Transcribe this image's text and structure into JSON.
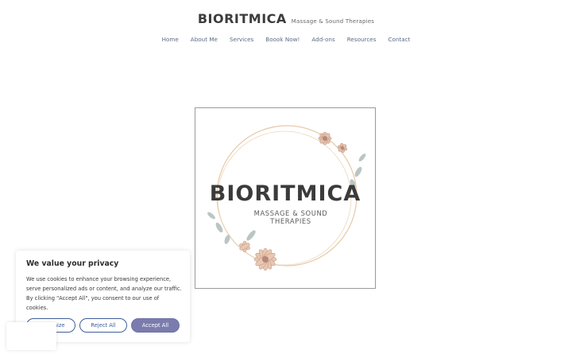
{
  "header": {
    "brand_title": "BIORITMICA",
    "brand_subtitle": "Massage & Sound Therapies"
  },
  "nav": {
    "items": [
      "Home",
      "About Me",
      "Services",
      "Boook Now!",
      "Add-ons",
      "Resources",
      "Contact"
    ]
  },
  "logo": {
    "title": "BIORITMICA",
    "subtitle": "MASSAGE & SOUND THERAPIES"
  },
  "cookie_banner": {
    "title": "We value your privacy",
    "text": "We use cookies to enhance your browsing experience, serve personalized ads or content, and analyze our traffic. By clicking \"Accept All\", you consent to our use of cookies.",
    "customize_label": "Customize",
    "reject_label": "Reject All",
    "accept_label": "Accept All"
  },
  "colors": {
    "nav_text": "#5c6b86",
    "button_outline": "#3f5f9a",
    "accept_fill": "#7b7cae"
  }
}
